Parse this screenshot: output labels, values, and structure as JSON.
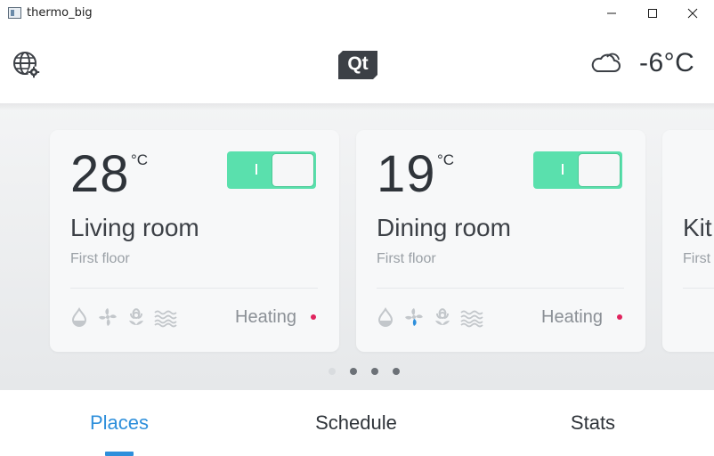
{
  "window": {
    "title": "thermo_big"
  },
  "header": {
    "logo_text": "Qt",
    "outdoor_temperature": "-6°C",
    "weather_icon": "cloud-icon",
    "settings_icon": "globe-gear-icon"
  },
  "rooms": [
    {
      "temperature": "28",
      "unit": "°C",
      "name": "Living room",
      "floor": "First floor",
      "status": "Heating",
      "power_on": true,
      "power_on_label": "I",
      "active_mode": "none"
    },
    {
      "temperature": "19",
      "unit": "°C",
      "name": "Dining room",
      "floor": "First floor",
      "status": "Heating",
      "power_on": true,
      "power_on_label": "I",
      "active_mode": "fan"
    },
    {
      "name": "Kit",
      "floor": "First"
    }
  ],
  "mode_icons": [
    "drop-icon",
    "fan-icon",
    "flower-icon",
    "heat-waves-icon"
  ],
  "pager": {
    "count": 4,
    "active_index": 0
  },
  "tabs": [
    {
      "label": "Places",
      "active": true
    },
    {
      "label": "Schedule",
      "active": false
    },
    {
      "label": "Stats",
      "active": false
    }
  ],
  "colors": {
    "accent_blue": "#2e8fdb",
    "toggle_green": "#5ae0ad",
    "status_dot": "#e0245e",
    "fan_active_blue": "#2e8fdb"
  }
}
